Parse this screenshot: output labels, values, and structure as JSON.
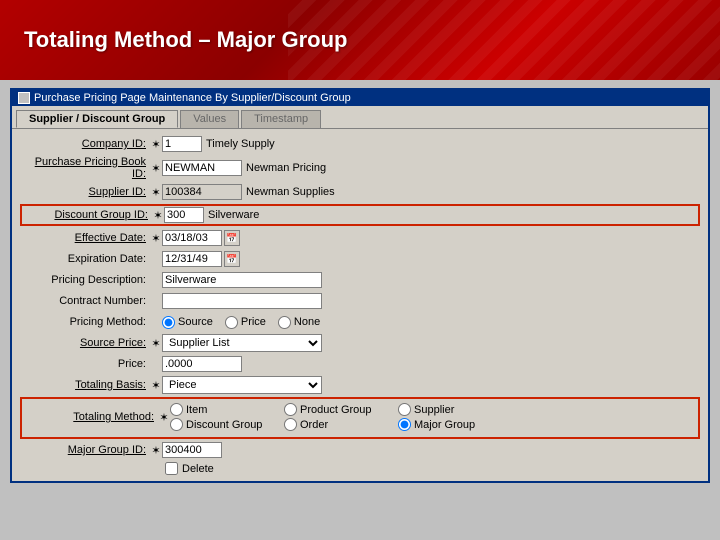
{
  "header": {
    "title": "Totaling Method – Major Group",
    "bg_color": "#8b0000"
  },
  "window": {
    "title": "Purchase Pricing Page Maintenance By Supplier/Discount Group",
    "tabs": [
      {
        "label": "Supplier / Discount Group",
        "active": true
      },
      {
        "label": "Values",
        "active": false
      },
      {
        "label": "Timestamp",
        "active": false
      }
    ]
  },
  "form": {
    "fields": {
      "company_id": {
        "label": "Company ID:",
        "required": true,
        "value": "1",
        "display": "Timely Supply"
      },
      "purchase_pricing_book_id": {
        "label": "Purchase Pricing Book ID:",
        "required": true,
        "value": "NEWMAN",
        "display": "Newman Pricing"
      },
      "supplier_id": {
        "label": "Supplier ID:",
        "required": true,
        "value": "100384",
        "display": "Newman Supplies"
      },
      "discount_group_id": {
        "label": "Discount Group ID:",
        "required": true,
        "value": "300",
        "display": "Silverware"
      },
      "effective_date": {
        "label": "Effective Date:",
        "required": true,
        "value": "03/18/03"
      },
      "expiration_date": {
        "label": "Expiration Date:",
        "required": false,
        "value": "12/31/49"
      },
      "pricing_description": {
        "label": "Pricing Description:",
        "required": false,
        "value": "Silverware"
      },
      "contract_number": {
        "label": "Contract Number:",
        "required": false,
        "value": ""
      },
      "pricing_method": {
        "label": "Pricing Method:",
        "required": false,
        "options": [
          "Source",
          "Price",
          "None"
        ],
        "selected": "Source"
      },
      "source_price": {
        "label": "Source Price:",
        "required": true,
        "value": "Supplier List",
        "options": [
          "Supplier List"
        ]
      },
      "price": {
        "label": "Price:",
        "required": false,
        "value": ".0000"
      },
      "totaling_basis": {
        "label": "Totaling Basis:",
        "required": true,
        "value": "Piece",
        "options": [
          "Piece"
        ]
      },
      "totaling_method": {
        "label": "Totaling Method:",
        "required": true,
        "radio_options": {
          "row1": [
            "Item",
            "Product Group",
            "Supplier"
          ],
          "row2": [
            "Discount Group",
            "Order",
            "Major Group"
          ]
        },
        "selected": "Major Group"
      },
      "major_group_id": {
        "label": "Major Group ID:",
        "required": true,
        "value": "300400"
      },
      "delete": {
        "label": "Delete",
        "checked": false
      }
    }
  }
}
